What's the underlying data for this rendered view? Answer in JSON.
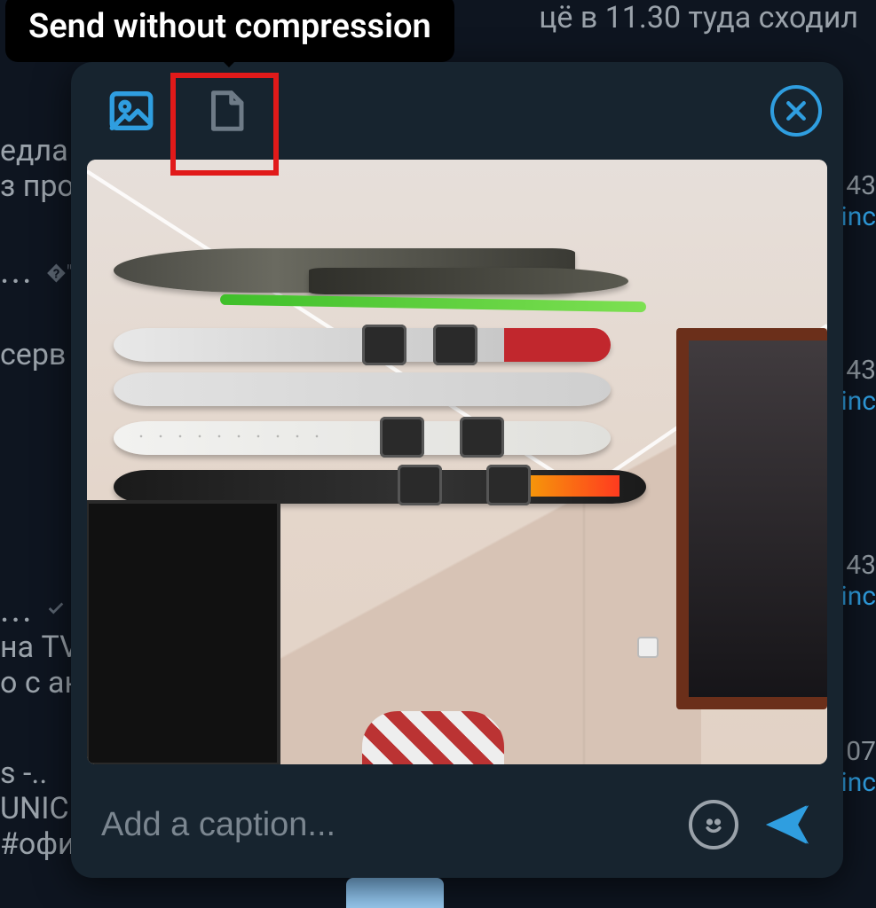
{
  "tooltip": {
    "text": "Send without compression"
  },
  "background": {
    "top_message": "цё в 11.30 туда сходил",
    "left_fragments": {
      "f1a": "едла",
      "f1b": "з про",
      "f2": "серв",
      "f3a": "на TV",
      "f3b": "о с ан",
      "f4a": "s -..",
      "f4b": "UNIC",
      "f4c": "#офи"
    },
    "dots": "...",
    "right_times": {
      "t1": "43",
      "t2": "43",
      "t3": "43",
      "t4": "07"
    },
    "right_link": "inc"
  },
  "modal": {
    "icons": {
      "photo_mode": "photo-icon",
      "file_mode": "file-icon",
      "close": "close-icon",
      "emoji": "emoji-icon",
      "send": "send-icon"
    },
    "caption_placeholder": "Add a caption...",
    "caption_value": ""
  },
  "colors": {
    "accent": "#2f9ee0",
    "highlight": "#e11a1a",
    "panel": "#17242f",
    "bg": "#0e1520"
  }
}
